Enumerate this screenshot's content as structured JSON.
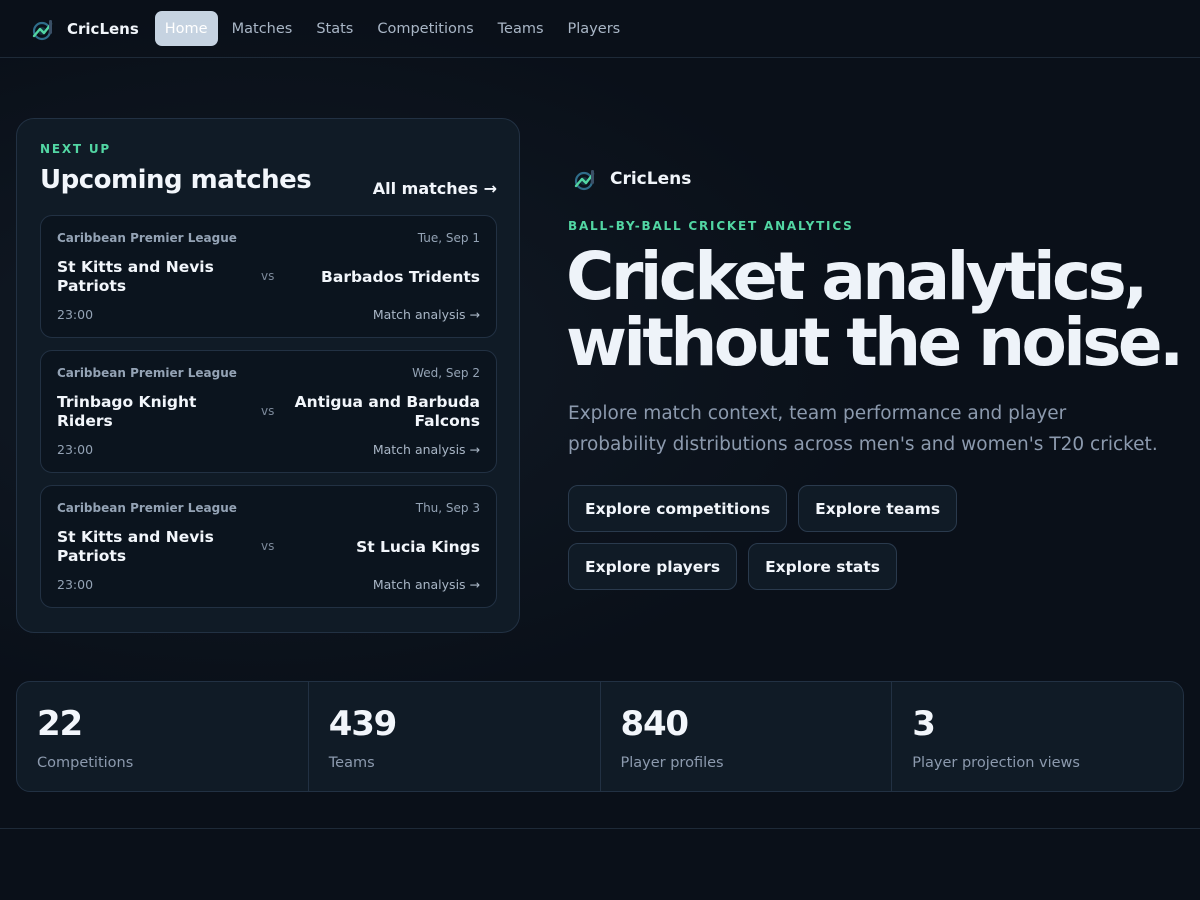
{
  "nav": {
    "brand": "CricLens",
    "items": [
      {
        "label": "Home",
        "active": true
      },
      {
        "label": "Matches",
        "active": false
      },
      {
        "label": "Stats",
        "active": false
      },
      {
        "label": "Competitions",
        "active": false
      },
      {
        "label": "Teams",
        "active": false
      },
      {
        "label": "Players",
        "active": false
      }
    ]
  },
  "upcoming": {
    "eyebrow": "NEXT UP",
    "title": "Upcoming matches",
    "all_link": "All matches →",
    "matches": [
      {
        "competition": "Caribbean Premier League",
        "date": "Tue, Sep 1",
        "home": "St Kitts and Nevis Patriots",
        "vs": "vs",
        "away": "Barbados Tridents",
        "time": "23:00",
        "link": "Match analysis →"
      },
      {
        "competition": "Caribbean Premier League",
        "date": "Wed, Sep 2",
        "home": "Trinbago Knight Riders",
        "vs": "vs",
        "away": "Antigua and Barbuda Falcons",
        "time": "23:00",
        "link": "Match analysis →"
      },
      {
        "competition": "Caribbean Premier League",
        "date": "Thu, Sep 3",
        "home": "St Kitts and Nevis Patriots",
        "vs": "vs",
        "away": "St Lucia Kings",
        "time": "23:00",
        "link": "Match analysis →"
      }
    ]
  },
  "hero": {
    "brand": "CricLens",
    "eyebrow": "BALL-BY-BALL CRICKET ANALYTICS",
    "title_line1": "Cricket analytics,",
    "title_line2": "without the noise.",
    "subtitle": "Explore match context, team performance and player probability distributions across men's and women's T20 cricket.",
    "buttons": [
      "Explore competitions",
      "Explore teams",
      "Explore players",
      "Explore stats"
    ]
  },
  "stats": [
    {
      "value": "22",
      "label": "Competitions"
    },
    {
      "value": "439",
      "label": "Teams"
    },
    {
      "value": "840",
      "label": "Player profiles"
    },
    {
      "value": "3",
      "label": "Player projection views"
    }
  ],
  "colors": {
    "accent_green": "#52d6a3",
    "background": "#0a1019",
    "card": "#101b26",
    "active_nav": "#c6d3e1"
  },
  "icons": {
    "logo": "criclens-logo-icon"
  }
}
